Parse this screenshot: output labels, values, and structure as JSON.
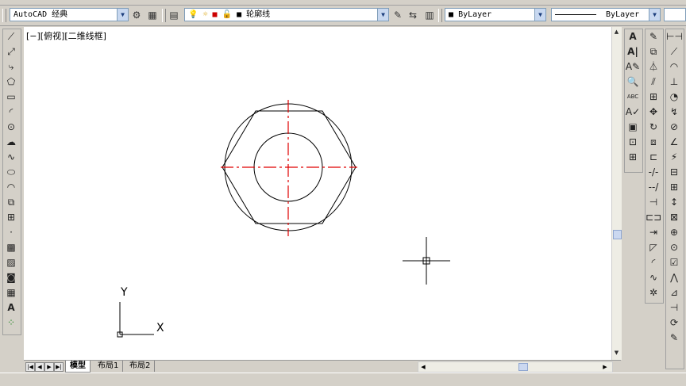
{
  "toolbar": {
    "workspace": "AutoCAD 经典",
    "layer": "轮廓线",
    "color": "ByLayer",
    "linetype": "ByLayer"
  },
  "viewport": {
    "label": "[−][俯视][二维线框]"
  },
  "ucs": {
    "x_label": "X",
    "y_label": "Y"
  },
  "layout_tabs": [
    "模型",
    "布局1",
    "布局2"
  ],
  "colors": {
    "center_line": "#e00000",
    "geometry": "#000000",
    "canvas": "#ffffff"
  }
}
